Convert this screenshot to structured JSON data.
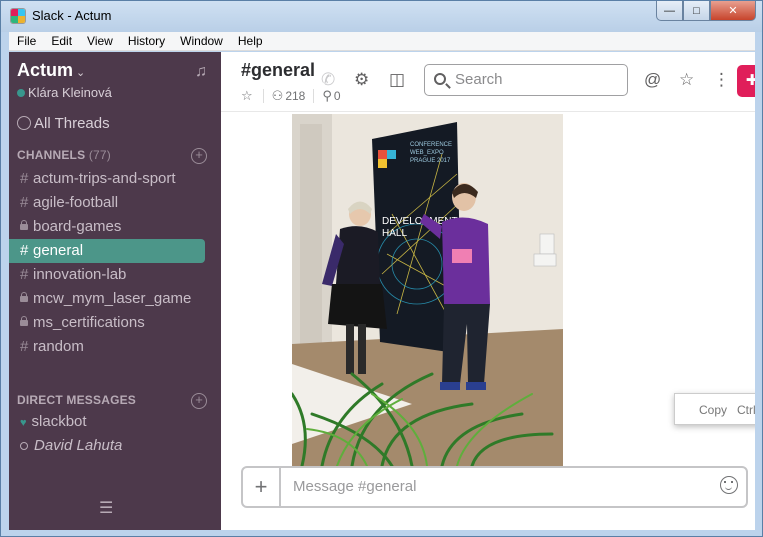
{
  "window": {
    "title": "Slack - Actum",
    "min": "—",
    "max": "□",
    "close": "✕"
  },
  "menu": [
    "File",
    "Edit",
    "View",
    "History",
    "Window",
    "Help"
  ],
  "sidebar": {
    "team": "Actum",
    "user": "Klára Kleinová",
    "all_threads": "All Threads",
    "channels_label": "CHANNELS",
    "channels_count": "(77)",
    "channels": [
      {
        "name": "actum-trips-and-sport",
        "private": false
      },
      {
        "name": "agile-football",
        "private": false
      },
      {
        "name": "board-games",
        "private": true
      },
      {
        "name": "general",
        "private": false,
        "active": true
      },
      {
        "name": "innovation-lab",
        "private": false
      },
      {
        "name": "mcw_mym_laser_game",
        "private": true
      },
      {
        "name": "ms_certifications",
        "private": true
      },
      {
        "name": "random",
        "private": false
      }
    ],
    "dm_label": "DIRECT MESSAGES",
    "dms": [
      {
        "name": "slackbot",
        "status": "heart"
      },
      {
        "name": "David Lahuta",
        "status": "away"
      }
    ]
  },
  "channel": {
    "title": "#general",
    "members": "218",
    "pins": "0"
  },
  "search": {
    "placeholder": "Search"
  },
  "context_menu": {
    "label": "Copy",
    "shortcut": "Ctrl+"
  },
  "composer": {
    "placeholder": "Message #general",
    "plus": "+"
  },
  "poster": {
    "line1": "CONFERENCE",
    "line2": "WEB_EXPO",
    "line3": "PRAGUE 2017",
    "hall1": "DEVELOPMENT",
    "hall2": "HALL"
  },
  "colors": {
    "sidebar": "#4d394b",
    "active_channel": "#4c9689",
    "accent_pink": "#e01e5a"
  }
}
